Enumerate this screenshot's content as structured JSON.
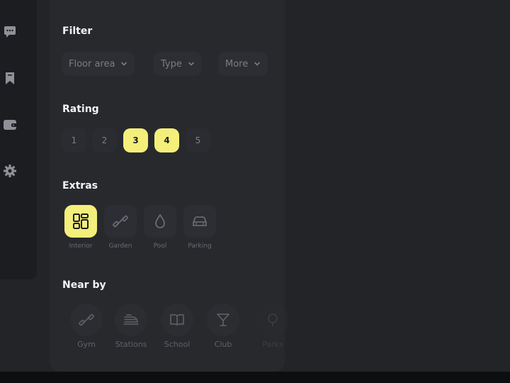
{
  "sidebar": {
    "icons": [
      "chat-icon",
      "bookmark-icon",
      "wallet-icon",
      "settings-icon"
    ]
  },
  "filter": {
    "title": "Filter",
    "dropdowns": [
      {
        "label": "Floor area"
      },
      {
        "label": "Type"
      },
      {
        "label": "More"
      }
    ]
  },
  "rating": {
    "title": "Rating",
    "options": [
      "1",
      "2",
      "3",
      "4",
      "5"
    ],
    "selected": [
      "3",
      "4"
    ]
  },
  "extras": {
    "title": "Extras",
    "items": [
      {
        "label": "Interior",
        "icon": "interior-icon",
        "selected": true
      },
      {
        "label": "Garden",
        "icon": "dumbbell-icon",
        "selected": false
      },
      {
        "label": "Pool",
        "icon": "drop-icon",
        "selected": false
      },
      {
        "label": "Parking",
        "icon": "car-icon",
        "selected": false
      }
    ]
  },
  "nearby": {
    "title": "Near by",
    "items": [
      {
        "label": "Gym",
        "icon": "dumbbell-icon"
      },
      {
        "label": "Stations",
        "icon": "train-icon"
      },
      {
        "label": "School",
        "icon": "book-icon"
      },
      {
        "label": "Club",
        "icon": "cocktail-icon"
      },
      {
        "label": "Parks",
        "icon": "tree-icon"
      }
    ]
  },
  "colors": {
    "accent": "#f3ef7a",
    "background": "#222428",
    "panel": "#27292d",
    "sidebar": "#1c1d21"
  }
}
